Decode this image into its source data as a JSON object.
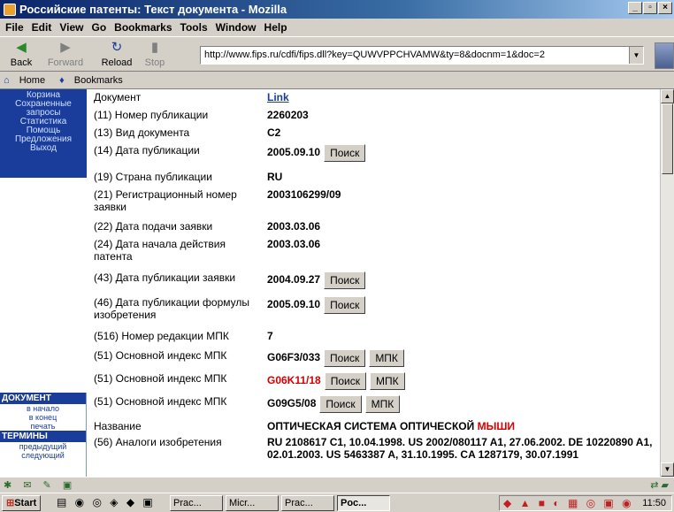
{
  "window": {
    "title": "Российские патенты: Текст документа - Mozilla",
    "minimize": "_",
    "restore": "▫",
    "close": "×"
  },
  "menu": [
    "File",
    "Edit",
    "View",
    "Go",
    "Bookmarks",
    "Tools",
    "Window",
    "Help"
  ],
  "nav": {
    "back": "Back",
    "forward": "Forward",
    "reload": "Reload",
    "stop": "Stop",
    "url": "http://www.fips.ru/cdfi/fips.dll?key=QUWVPPCHVAMW&ty=8&docnm=1&doc=2"
  },
  "personal": {
    "home": "Home",
    "bookmarks": "Bookmarks"
  },
  "sidebar": {
    "top_links": [
      "Корзина",
      "Сохраненные",
      "запросы",
      "Статистика",
      "Помощь",
      "Предложения",
      "Выход"
    ],
    "doc_head": "ДОКУМЕНТ",
    "doc_links": [
      "в начало",
      "в конец",
      "печать"
    ],
    "terms_head": "ТЕРМИНЫ",
    "terms_links": [
      "предыдущий",
      "следующий"
    ]
  },
  "doc": {
    "document_label": "Документ",
    "document_link": "Link",
    "rows": [
      {
        "label": "(11) Номер публикации",
        "value": "2260203"
      },
      {
        "label": "(13) Вид документа",
        "value": "C2"
      },
      {
        "label": "(14) Дата публикации",
        "value": "2005.09.10",
        "button": "Поиск"
      },
      {
        "label": "(19) Страна публикации",
        "value": "RU"
      },
      {
        "label": "(21) Регистрационный номер заявки",
        "value": "2003106299/09"
      },
      {
        "label": "(22) Дата подачи заявки",
        "value": "2003.03.06"
      },
      {
        "label": "(24) Дата начала действия патента",
        "value": "2003.03.06"
      },
      {
        "label": "(43) Дата публикации заявки",
        "value": "2004.09.27",
        "button": "Поиск"
      },
      {
        "label": "(46) Дата публикации формулы изобретения",
        "value": "2005.09.10",
        "button": "Поиск"
      },
      {
        "label": "(516) Номер редакции МПК",
        "value": "7"
      },
      {
        "label": "(51) Основной индекс МПК",
        "value": "G06F3/033",
        "button": "Поиск",
        "button2": "МПК"
      },
      {
        "label": "(51) Основной индекс МПК",
        "value": "G06K11/18",
        "button": "Поиск",
        "button2": "МПК",
        "highlight": true
      },
      {
        "label": "(51) Основной индекс МПК",
        "value": "G09G5/08",
        "button": "Поиск",
        "button2": "МПК"
      }
    ],
    "name_label": "Название",
    "name_value": "ОПТИЧЕСКАЯ СИСТЕМА ОПТИЧЕСКОЙ",
    "name_value_red": "МЫШИ",
    "analogs_label": "(56) Аналоги изобретения",
    "analogs_value": "RU 2108617 C1, 10.04.1998. US 2002/080117 A1, 27.06.2002. DE 10220890 A1, 02.01.2003. US 5463387 A, 31.10.1995. CA 1287179, 30.07.1991"
  },
  "taskbar": {
    "start": "Start",
    "tasks": [
      "Prac...",
      "Micr...",
      "Prac...",
      "Poc..."
    ],
    "clock": "11:50"
  },
  "colors": {
    "sidebar": "#1a3d9c",
    "highlight": "#d40000",
    "link": "#1a3d9c"
  }
}
